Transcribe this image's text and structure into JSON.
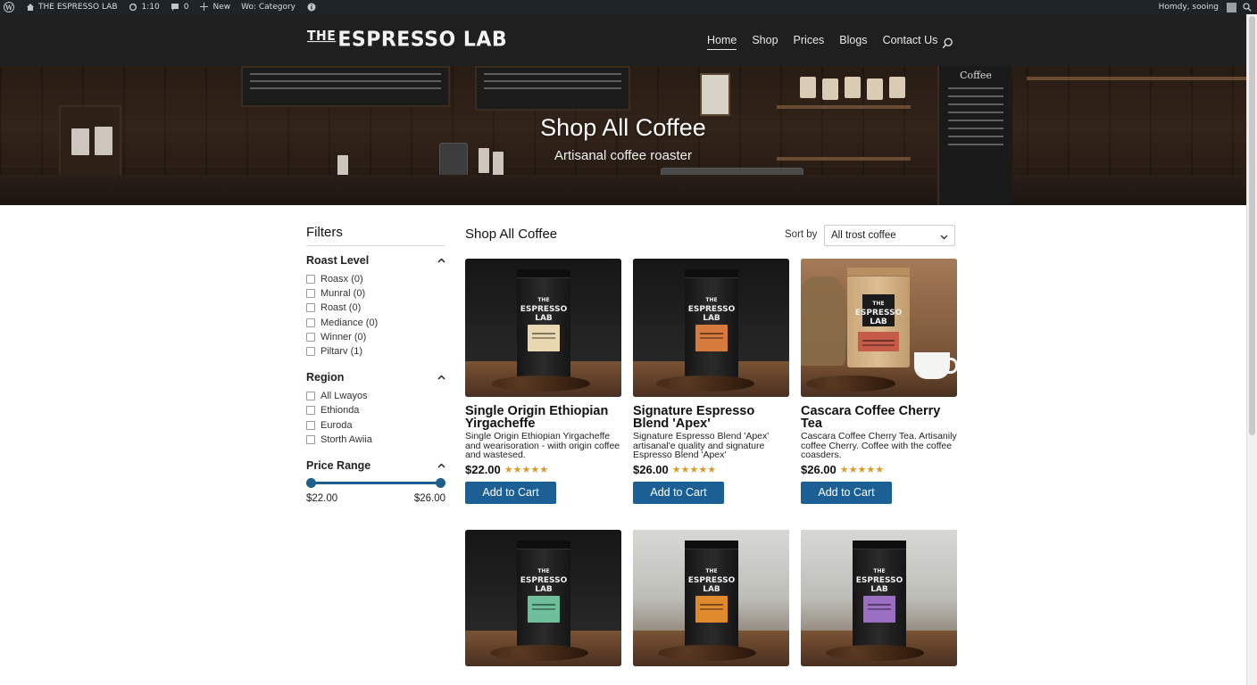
{
  "admin_bar": {
    "site_name": "THE ESPRESSO LAB",
    "updates": "1:10",
    "comments": "0",
    "new_label": "New",
    "category_label": "Wo: Category",
    "user_greeting": "Homdy, sooing"
  },
  "header": {
    "logo_the": "THE",
    "logo_name": "ESPRESSO LAB",
    "nav": [
      {
        "label": "Home",
        "active": true
      },
      {
        "label": "Shop",
        "active": false
      },
      {
        "label": "Prices",
        "active": false
      },
      {
        "label": "Blogs",
        "active": false
      },
      {
        "label": "Contact Us",
        "active": false
      }
    ]
  },
  "hero": {
    "title": "Shop All Coffee",
    "subtitle": "Artisanal coffee roaster",
    "board_title": "Coffee"
  },
  "filters": {
    "title": "Filters",
    "roast_level": {
      "heading": "Roast Level",
      "options": [
        "Roasx (0)",
        "Munral (0)",
        "Roast (0)",
        "Mediance (0)",
        "Winner (0)",
        "Piltarv (1)"
      ]
    },
    "region": {
      "heading": "Region",
      "options": [
        "All Lwayos",
        "Ethionda",
        "Euroda",
        "Storth Awiia"
      ]
    },
    "price_range": {
      "heading": "Price Range",
      "min": "$22.00",
      "max": "$26.00",
      "low_fraction": 0.0,
      "high_fraction": 1.0
    }
  },
  "main": {
    "title": "Shop All Coffee",
    "sort_label": "Sort by",
    "sort_value": "All trost coffee"
  },
  "products": [
    {
      "name": "Single Origin Ethiopian Yirgacheffe",
      "description": "Single Origin Ethiopian Yirgacheffe and wearisoration - wiith origin coffee and wastesed.",
      "price": "$22.00",
      "rating": 5,
      "button": "Add to Cart",
      "label_color": "#e8d7b0",
      "style": "dark"
    },
    {
      "name": "Signature Espresso Blend 'Apex'",
      "description": "Signature Espresso Blend 'Apex' artisanal'e quality and signature Espresso Blend 'Apex'",
      "price": "$26.00",
      "rating": 5,
      "button": "Add to Cart",
      "label_color": "#d77a3e",
      "style": "dark"
    },
    {
      "name": "Cascara Coffee Cherry Tea",
      "description": "Cascara Coffee Cherry Tea. Artisanily coffee Cherry. Coffee with the coffee coasders.",
      "price": "$26.00",
      "rating": 5,
      "button": "Add to Cart",
      "label_color": "#c75b4a",
      "style": "kraft"
    },
    {
      "label_color": "#6fbf9a",
      "style": "dark"
    },
    {
      "label_color": "#e08a2e",
      "style": "light"
    },
    {
      "label_color": "#9b6fc2",
      "style": "light"
    }
  ],
  "colors": {
    "accent": "#1b5f95",
    "header_bg": "#1f1f1f",
    "star": "#d79a2b"
  },
  "icons": {
    "search": "search-icon",
    "chevron_up": "chevron-up-icon",
    "chevron_down": "chevron-down-icon"
  }
}
